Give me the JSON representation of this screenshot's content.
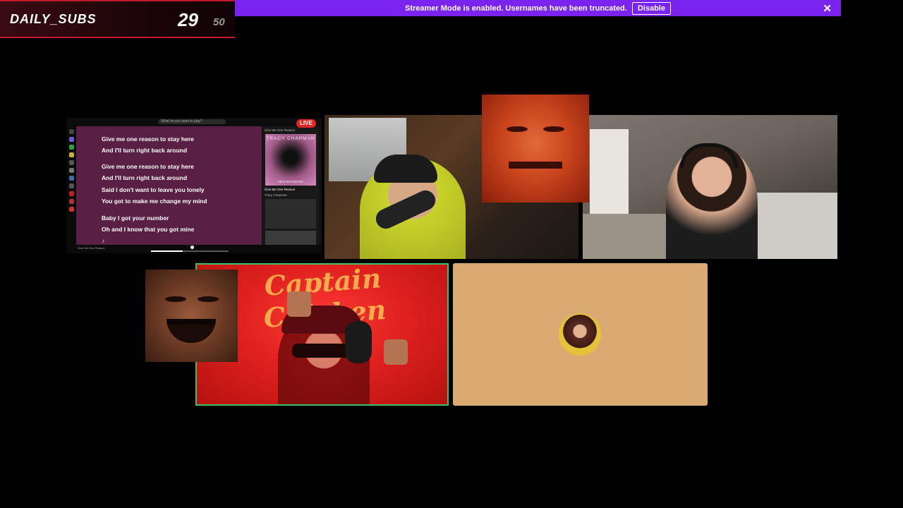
{
  "subs_widget": {
    "label": "DAILY_SUBS",
    "count": "29",
    "goal": "50"
  },
  "banner": {
    "message": "Streamer Mode is enabled. Usernames have been truncated.",
    "button_label": "Disable",
    "close_glyph": "✕"
  },
  "spotify": {
    "search_placeholder": "What do you want to play?",
    "live_badge": "LIVE",
    "lyrics": [
      "Give me one reason to stay here",
      "And I'll turn right back around",
      "Give me one reason to stay here",
      "And I'll turn right back around",
      "Said I don't want to leave you lonely",
      "You got to make me change my mind",
      "Baby I got your number",
      "Oh and I know that you got mine",
      "♪"
    ],
    "right_panel": {
      "header": "Give Me One Reason",
      "album_title": "TRACY CHAPMAN",
      "album_subtitle": "NEW BEGINNING",
      "song_title": "Give Me One Reason",
      "artist": "Tracy Chapman"
    },
    "now_playing": "Give Me One Reason"
  },
  "cam_stream": {
    "logo_text": "Captain Chicken"
  },
  "colors": {
    "banner_bg": "#7a22ee",
    "accent_red": "#c0182c",
    "lyrics_bg": "#5a1f45",
    "audio_tile_bg": "#d9ab72",
    "speaking_border": "#3fbf5f",
    "live_badge": "#e02424"
  },
  "icons": [
    "close-icon",
    "play-icon",
    "avatar"
  ]
}
